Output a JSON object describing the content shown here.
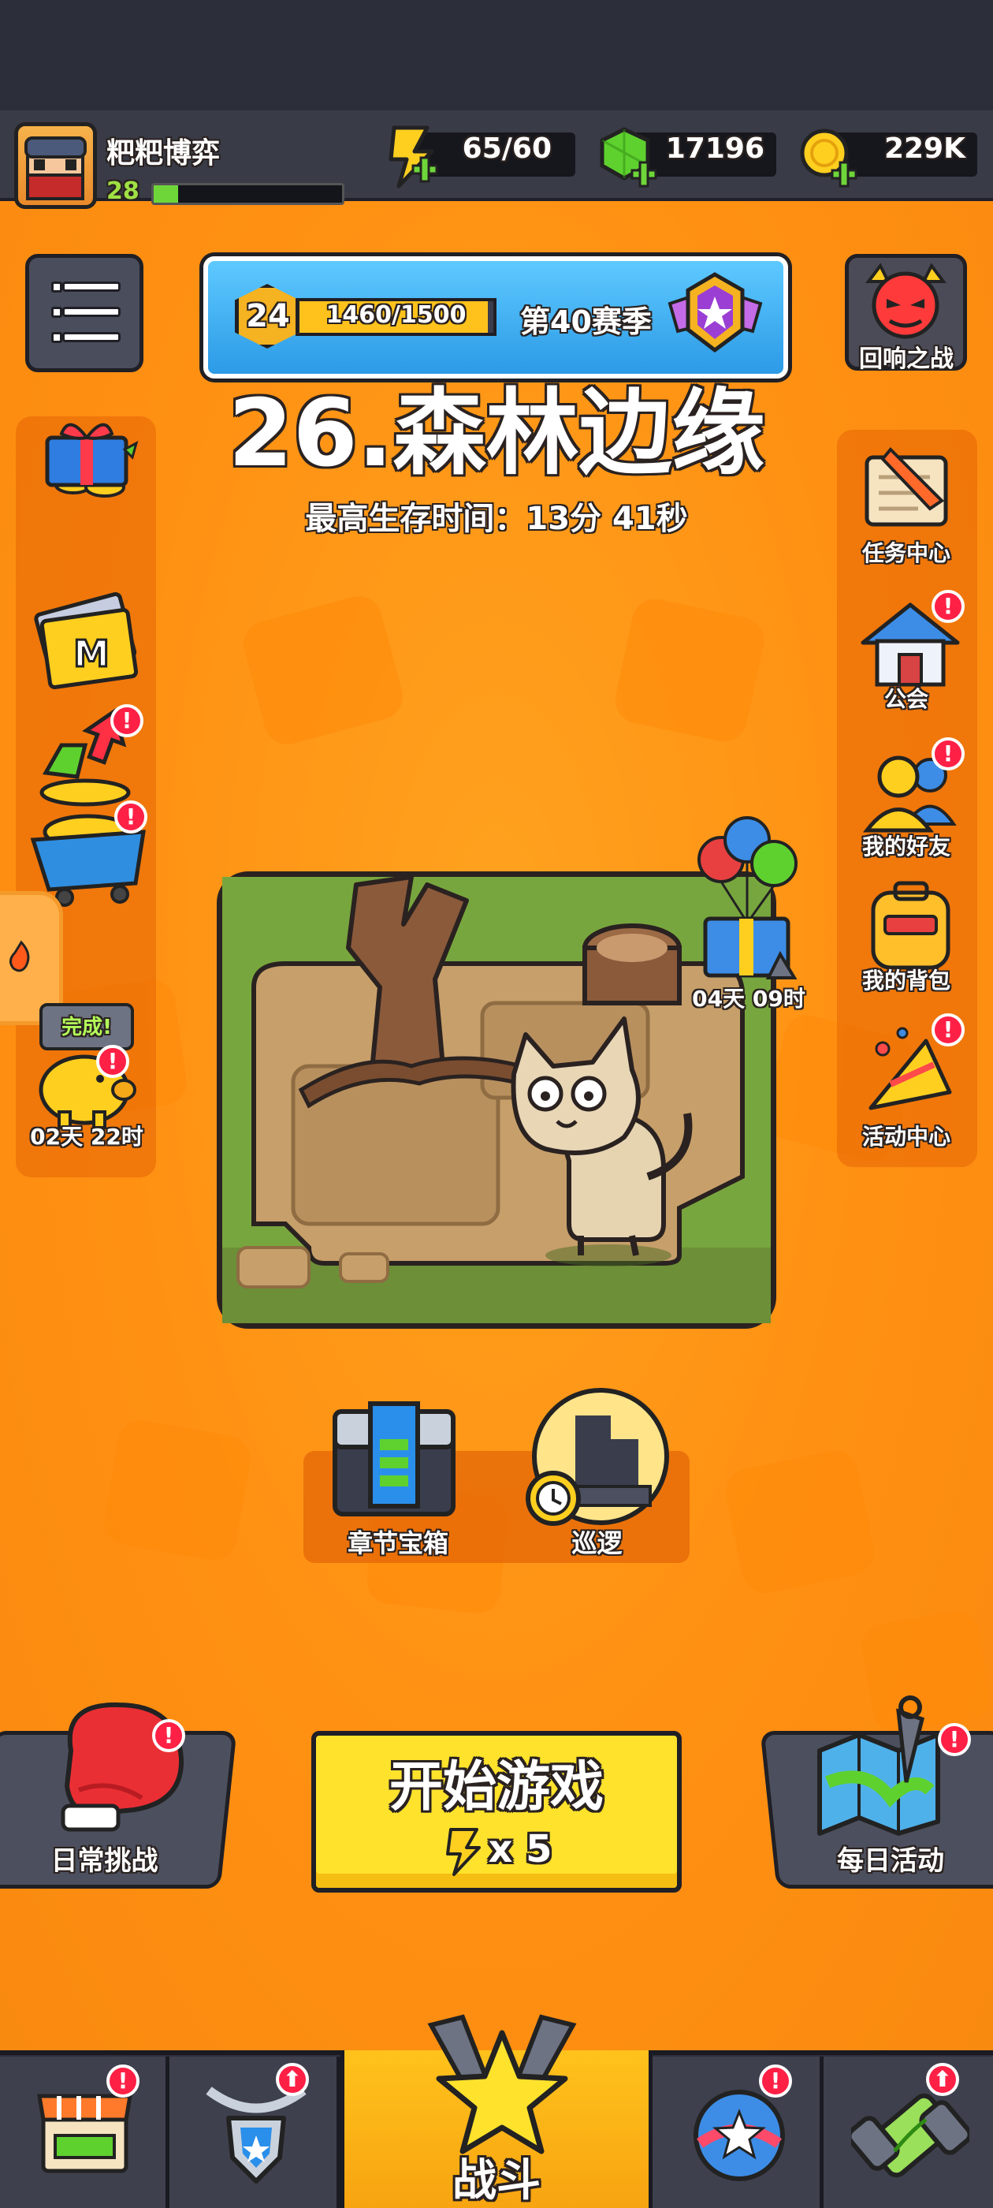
{
  "player": {
    "name": "粑粑博弈",
    "level": "28",
    "exp_fraction": 0.13
  },
  "resources": {
    "energy": "65/60",
    "gems": "17196",
    "coins": "229K"
  },
  "season": {
    "level": "24",
    "xp": "1460/1500",
    "xp_fraction": 0.973,
    "name": "第40赛季"
  },
  "boss_button": {
    "label": "回响之战"
  },
  "stage": {
    "title": "26.森林边缘",
    "best_time": "最高生存时间：13分 41秒"
  },
  "left_side": {
    "piggy_bubble": "完成!",
    "piggy_timer": "02天 22时"
  },
  "map": {
    "gift_timer": "04天 09时"
  },
  "right_side": {
    "items": [
      {
        "label": "任务中心"
      },
      {
        "label": "公会"
      },
      {
        "label": "我的好友"
      },
      {
        "label": "我的背包"
      },
      {
        "label": "活动中心"
      }
    ]
  },
  "chest": {
    "chapter_chest": "章节宝箱",
    "patrol": "巡逻"
  },
  "actions": {
    "daily_challenge": "日常挑战",
    "start_game": "开始游戏",
    "start_cost": "x 5",
    "daily_activity": "每日活动"
  },
  "nav": {
    "battle": "战斗"
  },
  "colors": {
    "orange": "#ff9012",
    "yellow_button": "#ffe22c",
    "badge_red": "#ff2046",
    "gem_green": "#5fd12f"
  }
}
